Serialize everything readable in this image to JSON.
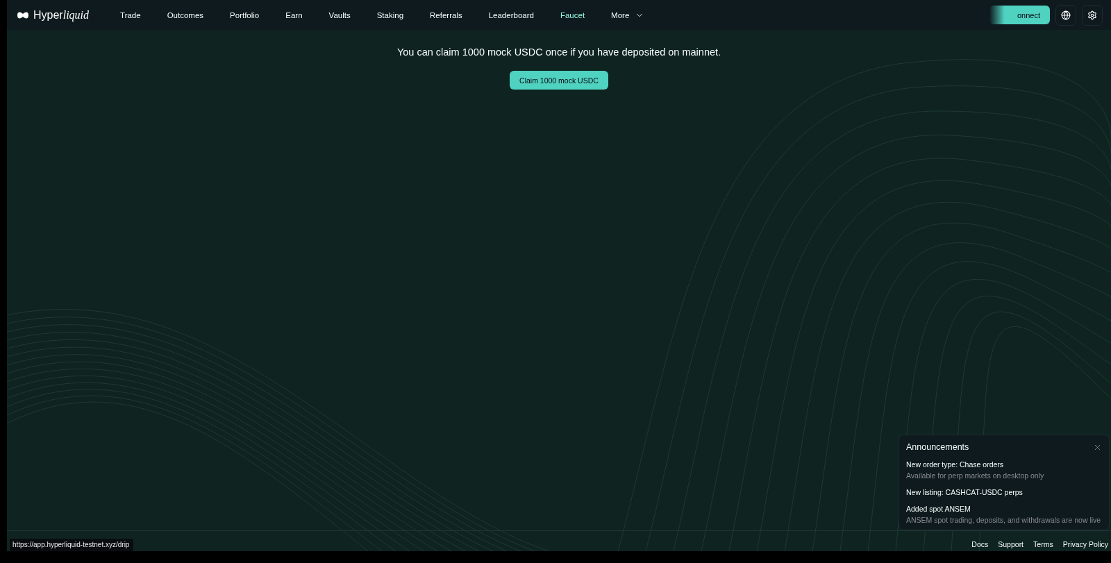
{
  "logo": {
    "text": "Hyper",
    "italic_text": "liquid"
  },
  "nav": [
    {
      "label": "Trade",
      "selected": false
    },
    {
      "label": "Outcomes",
      "selected": false
    },
    {
      "label": "Portfolio",
      "selected": false
    },
    {
      "label": "Earn",
      "selected": false
    },
    {
      "label": "Vaults",
      "selected": false
    },
    {
      "label": "Staking",
      "selected": false
    },
    {
      "label": "Referrals",
      "selected": false
    },
    {
      "label": "Leaderboard",
      "selected": false
    },
    {
      "label": "Faucet",
      "selected": true
    },
    {
      "label": "More",
      "selected": false,
      "kind": "dropdown"
    }
  ],
  "connect_button": "onnect",
  "message": "You can claim 1000 mock USDC once if you have deposited on mainnet.",
  "claim_button": "Claim 1000 mock USDC",
  "announcements": {
    "title": "Announcements",
    "items": [
      {
        "title": "New order type: Chase orders",
        "body": "Available for perp markets on desktop only"
      },
      {
        "title": "New listing: CASHCAT-USDC perps"
      },
      {
        "title": "Added spot ANSEM",
        "body": "ANSEM spot trading, deposits, and withdrawals are now live"
      }
    ]
  },
  "footer_links": [
    "Docs",
    "Support",
    "Terms",
    "Privacy Policy"
  ],
  "status_url": "https://app.hyperliquid-testnet.xyz/drip"
}
